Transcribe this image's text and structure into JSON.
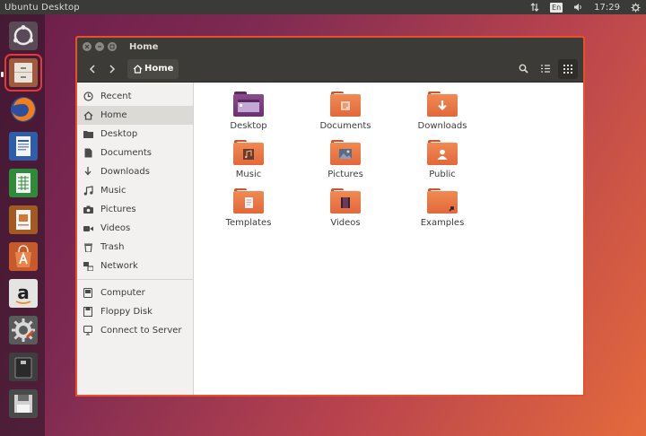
{
  "top_panel": {
    "title": "Ubuntu Desktop",
    "keyboard_layout": "En",
    "clock": "17:29"
  },
  "launcher": {
    "items": [
      {
        "name": "dash-home",
        "icon": "ubuntu-logo-icon"
      },
      {
        "name": "files",
        "icon": "file-cabinet-icon",
        "active": true
      },
      {
        "name": "firefox",
        "icon": "firefox-icon"
      },
      {
        "name": "libreoffice-writer",
        "icon": "writer-icon"
      },
      {
        "name": "libreoffice-calc",
        "icon": "calc-icon"
      },
      {
        "name": "libreoffice-impress",
        "icon": "impress-icon"
      },
      {
        "name": "software-center",
        "icon": "software-center-icon"
      },
      {
        "name": "amazon",
        "icon": "amazon-icon",
        "label": "a"
      },
      {
        "name": "system-settings",
        "icon": "settings-gear-icon"
      },
      {
        "name": "usb-drive",
        "icon": "usb-drive-icon"
      },
      {
        "name": "floppy",
        "icon": "floppy-icon"
      }
    ]
  },
  "window": {
    "title": "Home",
    "path_button": "Home",
    "colors": {
      "accent": "#e8502c",
      "header": "#3c3b37",
      "folder": "#e9743f"
    }
  },
  "sidebar": {
    "places": [
      {
        "label": "Recent",
        "icon": "clock-icon"
      },
      {
        "label": "Home",
        "icon": "home-icon",
        "selected": true
      },
      {
        "label": "Desktop",
        "icon": "folder-icon"
      },
      {
        "label": "Documents",
        "icon": "document-icon"
      },
      {
        "label": "Downloads",
        "icon": "download-icon"
      },
      {
        "label": "Music",
        "icon": "music-note-icon"
      },
      {
        "label": "Pictures",
        "icon": "camera-icon"
      },
      {
        "label": "Videos",
        "icon": "video-icon"
      },
      {
        "label": "Trash",
        "icon": "trash-icon"
      },
      {
        "label": "Network",
        "icon": "network-icon"
      }
    ],
    "devices": [
      {
        "label": "Computer",
        "icon": "computer-icon"
      },
      {
        "label": "Floppy Disk",
        "icon": "floppy-disk-icon"
      },
      {
        "label": "Connect to Server",
        "icon": "server-icon"
      }
    ]
  },
  "files": [
    {
      "label": "Desktop",
      "type": "desktop"
    },
    {
      "label": "Documents",
      "type": "documents"
    },
    {
      "label": "Downloads",
      "type": "downloads"
    },
    {
      "label": "Music",
      "type": "music"
    },
    {
      "label": "Pictures",
      "type": "pictures"
    },
    {
      "label": "Public",
      "type": "public"
    },
    {
      "label": "Templates",
      "type": "templates"
    },
    {
      "label": "Videos",
      "type": "videos"
    },
    {
      "label": "Examples",
      "type": "examples"
    }
  ]
}
